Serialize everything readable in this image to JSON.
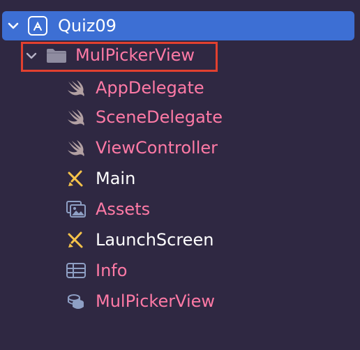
{
  "project": {
    "name": "Quiz09",
    "icon": "xcode-project-icon"
  },
  "group": {
    "name": "MulPickerView",
    "icon": "folder-icon"
  },
  "files": [
    {
      "name": "AppDelegate",
      "icon": "swift-icon",
      "color": "#ff7aa6"
    },
    {
      "name": "SceneDelegate",
      "icon": "swift-icon",
      "color": "#ff7aa6"
    },
    {
      "name": "ViewController",
      "icon": "swift-icon",
      "color": "#ff7aa6"
    },
    {
      "name": "Main",
      "icon": "storyboard-icon",
      "color": "#ffffff"
    },
    {
      "name": "Assets",
      "icon": "asset-catalog-icon",
      "color": "#ff7aa6"
    },
    {
      "name": "LaunchScreen",
      "icon": "storyboard-icon",
      "color": "#ffffff"
    },
    {
      "name": "Info",
      "icon": "plist-icon",
      "color": "#ff7aa6"
    },
    {
      "name": "MulPickerView",
      "icon": "core-data-model-icon",
      "color": "#ff7aa6"
    }
  ],
  "colors": {
    "selection": "#3d6fd4",
    "highlight_box": "#e2402f",
    "modified_text": "#ff7aa6",
    "background": "#2f2842"
  }
}
